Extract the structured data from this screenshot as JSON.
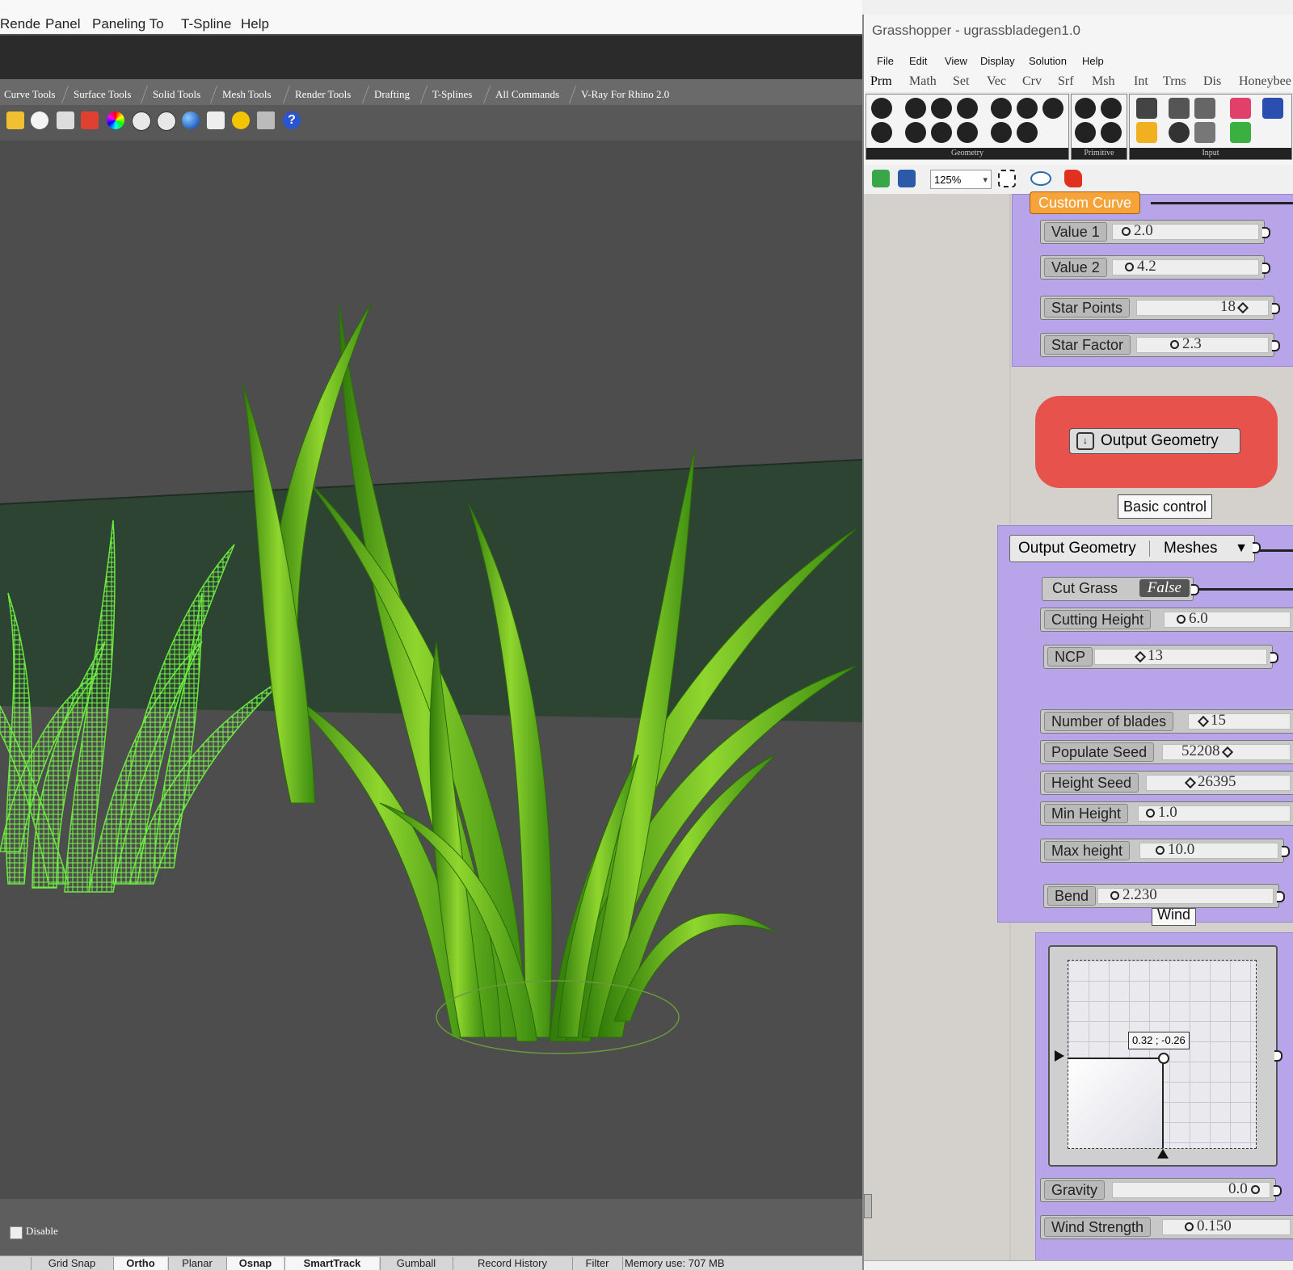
{
  "rhino": {
    "menu": [
      "Rende",
      "Panel",
      "Paneling To",
      "T-Spline",
      "Help"
    ],
    "toolbar_tabs": [
      "Curve Tools",
      "Surface Tools",
      "Solid Tools",
      "Mesh Tools",
      "Render Tools",
      "Drafting",
      "T-Splines",
      "All Commands",
      "V-Ray For Rhino 2.0"
    ],
    "command_area": {
      "disable_label": "Disable"
    },
    "status_panes": [
      {
        "label": "Grid Snap",
        "on": false
      },
      {
        "label": "Ortho",
        "on": true
      },
      {
        "label": "Planar",
        "on": false
      },
      {
        "label": "Osnap",
        "on": true
      },
      {
        "label": "SmartTrack",
        "on": true
      },
      {
        "label": "Gumball",
        "on": false
      },
      {
        "label": "Record History",
        "on": false
      },
      {
        "label": "Filter",
        "on": false
      }
    ],
    "memory": "Memory use: 707 MB"
  },
  "grasshopper": {
    "title": "Grasshopper - ugrassbladegen1.0",
    "menu": [
      "File",
      "Edit",
      "View",
      "Display",
      "Solution",
      "Help"
    ],
    "tabs": [
      "Prm",
      "Math",
      "Set",
      "Vec",
      "Crv",
      "Srf",
      "Msh",
      "Int",
      "Trns",
      "Dis",
      "Honeybee"
    ],
    "ribbon_groups": [
      "Geometry",
      "Primitive",
      "Input"
    ],
    "zoom": "125%",
    "nodes": {
      "custom_curve": "Custom Curve",
      "value1": {
        "label": "Value 1",
        "value": "2.0"
      },
      "value2": {
        "label": "Value 2",
        "value": "4.2"
      },
      "star_points": {
        "label": "Star Points",
        "value": "18"
      },
      "star_factor": {
        "label": "Star Factor",
        "value": "2.3"
      },
      "output_geometry": "Output Geometry",
      "basic_control": "Basic control",
      "output_list": {
        "label": "Output Geometry",
        "value": "Meshes"
      },
      "cut_grass": {
        "label": "Cut Grass",
        "value": "False"
      },
      "cutting_height": {
        "label": "Cutting Height",
        "value": "6.0"
      },
      "ncp": {
        "label": "NCP",
        "value": "13"
      },
      "num_blades": {
        "label": "Number of blades",
        "value": "15"
      },
      "populate_seed": {
        "label": "Populate Seed",
        "value": "52208"
      },
      "height_seed": {
        "label": "Height Seed",
        "value": "26395"
      },
      "min_height": {
        "label": "Min Height",
        "value": "1.0"
      },
      "max_height": {
        "label": "Max height",
        "value": "10.0"
      },
      "bend": {
        "label": "Bend",
        "value": "2.230"
      },
      "wind_label": "Wind",
      "graph_tip": "0.32 ; -0.26",
      "gravity": {
        "label": "Gravity",
        "value": "0.0"
      },
      "wind_strength": {
        "label": "Wind Strength",
        "value": "0.150"
      }
    }
  }
}
